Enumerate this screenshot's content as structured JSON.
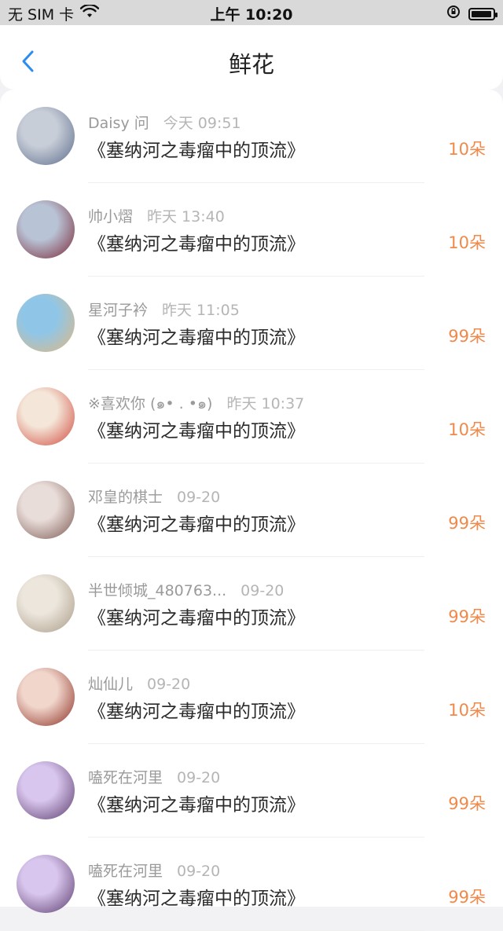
{
  "status_bar": {
    "carrier": "无 SIM 卡",
    "time": "上午 10:20"
  },
  "nav": {
    "title": "鲜花"
  },
  "colors": {
    "accent": "#2d8cf0",
    "amount": "#f0894a"
  },
  "rows": [
    {
      "name": "Daisy 问",
      "time": "今天 09:51",
      "book": "《塞纳河之毒瘤中的顶流》",
      "amount": "10朵",
      "avatar_colors": [
        "#c8ced8",
        "#5a6a8a"
      ]
    },
    {
      "name": "帅小熠",
      "time": "昨天 13:40",
      "book": "《塞纳河之毒瘤中的顶流》",
      "amount": "10朵",
      "avatar_colors": [
        "#b8c4d6",
        "#7a2434"
      ]
    },
    {
      "name": "星河子衿",
      "time": "昨天 11:05",
      "book": "《塞纳河之毒瘤中的顶流》",
      "amount": "99朵",
      "avatar_colors": [
        "#8fc6e8",
        "#e2b880"
      ]
    },
    {
      "name": "※喜欢你 (๑• . •๑)",
      "time": "昨天 10:37",
      "book": "《塞纳河之毒瘤中的顶流》",
      "amount": "10朵",
      "avatar_colors": [
        "#f4e6d8",
        "#d0463a"
      ]
    },
    {
      "name": "邓皇的棋士",
      "time": "09-20",
      "book": "《塞纳河之毒瘤中的顶流》",
      "amount": "99朵",
      "avatar_colors": [
        "#e9ddd9",
        "#7a5650"
      ]
    },
    {
      "name": "半世倾城_480763...",
      "time": "09-20",
      "book": "《塞纳河之毒瘤中的顶流》",
      "amount": "99朵",
      "avatar_colors": [
        "#ece6dc",
        "#a89a86"
      ]
    },
    {
      "name": "灿仙儿",
      "time": "09-20",
      "book": "《塞纳河之毒瘤中的顶流》",
      "amount": "10朵",
      "avatar_colors": [
        "#f1d6cc",
        "#8a2a1e"
      ]
    },
    {
      "name": "嗑死在河里",
      "time": "09-20",
      "book": "《塞纳河之毒瘤中的顶流》",
      "amount": "99朵",
      "avatar_colors": [
        "#d8c6ee",
        "#5a3a6a"
      ]
    },
    {
      "name": "嗑死在河里",
      "time": "09-20",
      "book": "《塞纳河之毒瘤中的顶流》",
      "amount": "99朵",
      "avatar_colors": [
        "#d8c6ee",
        "#5a3a6a"
      ]
    }
  ]
}
